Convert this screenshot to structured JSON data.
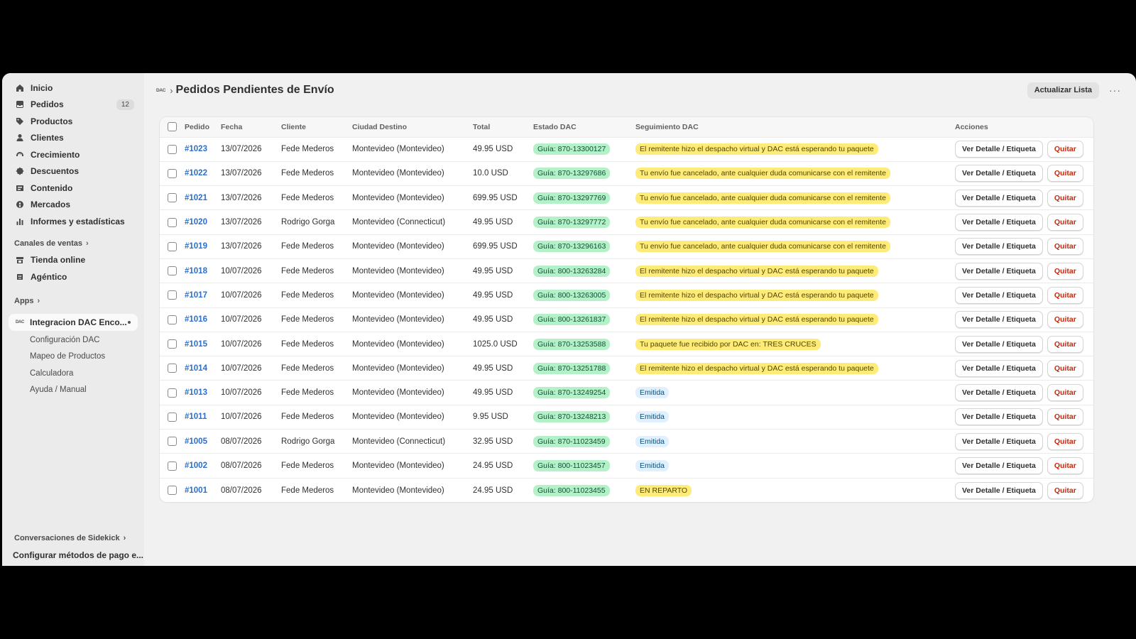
{
  "sidebar": {
    "nav": [
      {
        "label": "Inicio",
        "icon": "home-icon"
      },
      {
        "label": "Pedidos",
        "icon": "inbox-icon",
        "badge": "12"
      },
      {
        "label": "Productos",
        "icon": "tag-icon"
      },
      {
        "label": "Clientes",
        "icon": "person-icon"
      },
      {
        "label": "Crecimiento",
        "icon": "gauge-icon"
      },
      {
        "label": "Descuentos",
        "icon": "discount-icon"
      },
      {
        "label": "Contenido",
        "icon": "content-icon"
      },
      {
        "label": "Mercados",
        "icon": "globe-icon"
      },
      {
        "label": "Informes y estadísticas",
        "icon": "chart-icon"
      }
    ],
    "sales_channels_title": "Canales de ventas",
    "sales_channels": [
      {
        "label": "Tienda online",
        "icon": "store-icon"
      },
      {
        "label": "Agéntico",
        "icon": "agent-icon"
      }
    ],
    "apps_title": "Apps",
    "app": {
      "logo": "DAC",
      "label": "Integracion DAC Enco..."
    },
    "app_subitems": [
      "Configuración DAC",
      "Mapeo de Productos",
      "Calculadora",
      "Ayuda / Manual"
    ],
    "sidekick": "Conversaciones de Sidekick",
    "config_link": "Configurar métodos de pago e..."
  },
  "header": {
    "logo": "DAC",
    "title": "Pedidos Pendientes de Envío",
    "refresh_label": "Actualizar Lista",
    "more": "···"
  },
  "table": {
    "headers": {
      "order": "Pedido",
      "date": "Fecha",
      "client": "Cliente",
      "city": "Ciudad Destino",
      "total": "Total",
      "dac_status": "Estado DAC",
      "tracking": "Seguimiento DAC",
      "actions": "Acciones"
    },
    "detail_label": "Ver Detalle / Etiqueta",
    "remove_label": "Quitar",
    "rows": [
      {
        "order": "#1023",
        "date": "13/07/2026",
        "client": "Fede Mederos",
        "city": "Montevideo (Montevideo)",
        "total": "49.95 USD",
        "guia": "Guía: 870-13300127",
        "tracking": "El remitente hizo el despacho virtual y DAC está esperando tu paquete",
        "tracking_type": "warn"
      },
      {
        "order": "#1022",
        "date": "13/07/2026",
        "client": "Fede Mederos",
        "city": "Montevideo (Montevideo)",
        "total": "10.0 USD",
        "guia": "Guía: 870-13297686",
        "tracking": "Tu envío fue cancelado, ante cualquier duda comunicarse con el remitente",
        "tracking_type": "warn"
      },
      {
        "order": "#1021",
        "date": "13/07/2026",
        "client": "Fede Mederos",
        "city": "Montevideo (Montevideo)",
        "total": "699.95 USD",
        "guia": "Guía: 870-13297769",
        "tracking": "Tu envío fue cancelado, ante cualquier duda comunicarse con el remitente",
        "tracking_type": "warn"
      },
      {
        "order": "#1020",
        "date": "13/07/2026",
        "client": "Rodrigo Gorga",
        "city": "Montevideo (Connecticut)",
        "total": "49.95 USD",
        "guia": "Guía: 870-13297772",
        "tracking": "Tu envío fue cancelado, ante cualquier duda comunicarse con el remitente",
        "tracking_type": "warn"
      },
      {
        "order": "#1019",
        "date": "13/07/2026",
        "client": "Fede Mederos",
        "city": "Montevideo (Montevideo)",
        "total": "699.95 USD",
        "guia": "Guía: 870-13296163",
        "tracking": "Tu envío fue cancelado, ante cualquier duda comunicarse con el remitente",
        "tracking_type": "warn"
      },
      {
        "order": "#1018",
        "date": "10/07/2026",
        "client": "Fede Mederos",
        "city": "Montevideo (Montevideo)",
        "total": "49.95 USD",
        "guia": "Guía: 800-13263284",
        "tracking": "El remitente hizo el despacho virtual y DAC está esperando tu paquete",
        "tracking_type": "warn"
      },
      {
        "order": "#1017",
        "date": "10/07/2026",
        "client": "Fede Mederos",
        "city": "Montevideo (Montevideo)",
        "total": "49.95 USD",
        "guia": "Guía: 800-13263005",
        "tracking": "El remitente hizo el despacho virtual y DAC está esperando tu paquete",
        "tracking_type": "warn"
      },
      {
        "order": "#1016",
        "date": "10/07/2026",
        "client": "Fede Mederos",
        "city": "Montevideo (Montevideo)",
        "total": "49.95 USD",
        "guia": "Guía: 800-13261837",
        "tracking": "El remitente hizo el despacho virtual y DAC está esperando tu paquete",
        "tracking_type": "warn"
      },
      {
        "order": "#1015",
        "date": "10/07/2026",
        "client": "Fede Mederos",
        "city": "Montevideo (Montevideo)",
        "total": "1025.0 USD",
        "guia": "Guía: 870-13253588",
        "tracking": "Tu paquete fue recibido por DAC en: TRES CRUCES",
        "tracking_type": "warn"
      },
      {
        "order": "#1014",
        "date": "10/07/2026",
        "client": "Fede Mederos",
        "city": "Montevideo (Montevideo)",
        "total": "49.95 USD",
        "guia": "Guía: 870-13251788",
        "tracking": "El remitente hizo el despacho virtual y DAC está esperando tu paquete",
        "tracking_type": "warn"
      },
      {
        "order": "#1013",
        "date": "10/07/2026",
        "client": "Fede Mederos",
        "city": "Montevideo (Montevideo)",
        "total": "49.95 USD",
        "guia": "Guía: 870-13249254",
        "tracking": "Emitida",
        "tracking_type": "info"
      },
      {
        "order": "#1011",
        "date": "10/07/2026",
        "client": "Fede Mederos",
        "city": "Montevideo (Montevideo)",
        "total": "9.95 USD",
        "guia": "Guía: 870-13248213",
        "tracking": "Emitida",
        "tracking_type": "info"
      },
      {
        "order": "#1005",
        "date": "08/07/2026",
        "client": "Rodrigo Gorga",
        "city": "Montevideo (Connecticut)",
        "total": "32.95 USD",
        "guia": "Guía: 870-11023459",
        "tracking": "Emitida",
        "tracking_type": "info"
      },
      {
        "order": "#1002",
        "date": "08/07/2026",
        "client": "Fede Mederos",
        "city": "Montevideo (Montevideo)",
        "total": "24.95 USD",
        "guia": "Guía: 800-11023457",
        "tracking": "Emitida",
        "tracking_type": "info"
      },
      {
        "order": "#1001",
        "date": "08/07/2026",
        "client": "Fede Mederos",
        "city": "Montevideo (Montevideo)",
        "total": "24.95 USD",
        "guia": "Guía: 800-11023455",
        "tracking": "EN REPARTO",
        "tracking_type": "warn"
      }
    ]
  },
  "colors": {
    "link": "#2c6ecb",
    "guia_bg": "#b4f1c8",
    "warn_bg": "#ffeb78",
    "info_bg": "#e0f0ff",
    "danger": "#c5280c"
  }
}
